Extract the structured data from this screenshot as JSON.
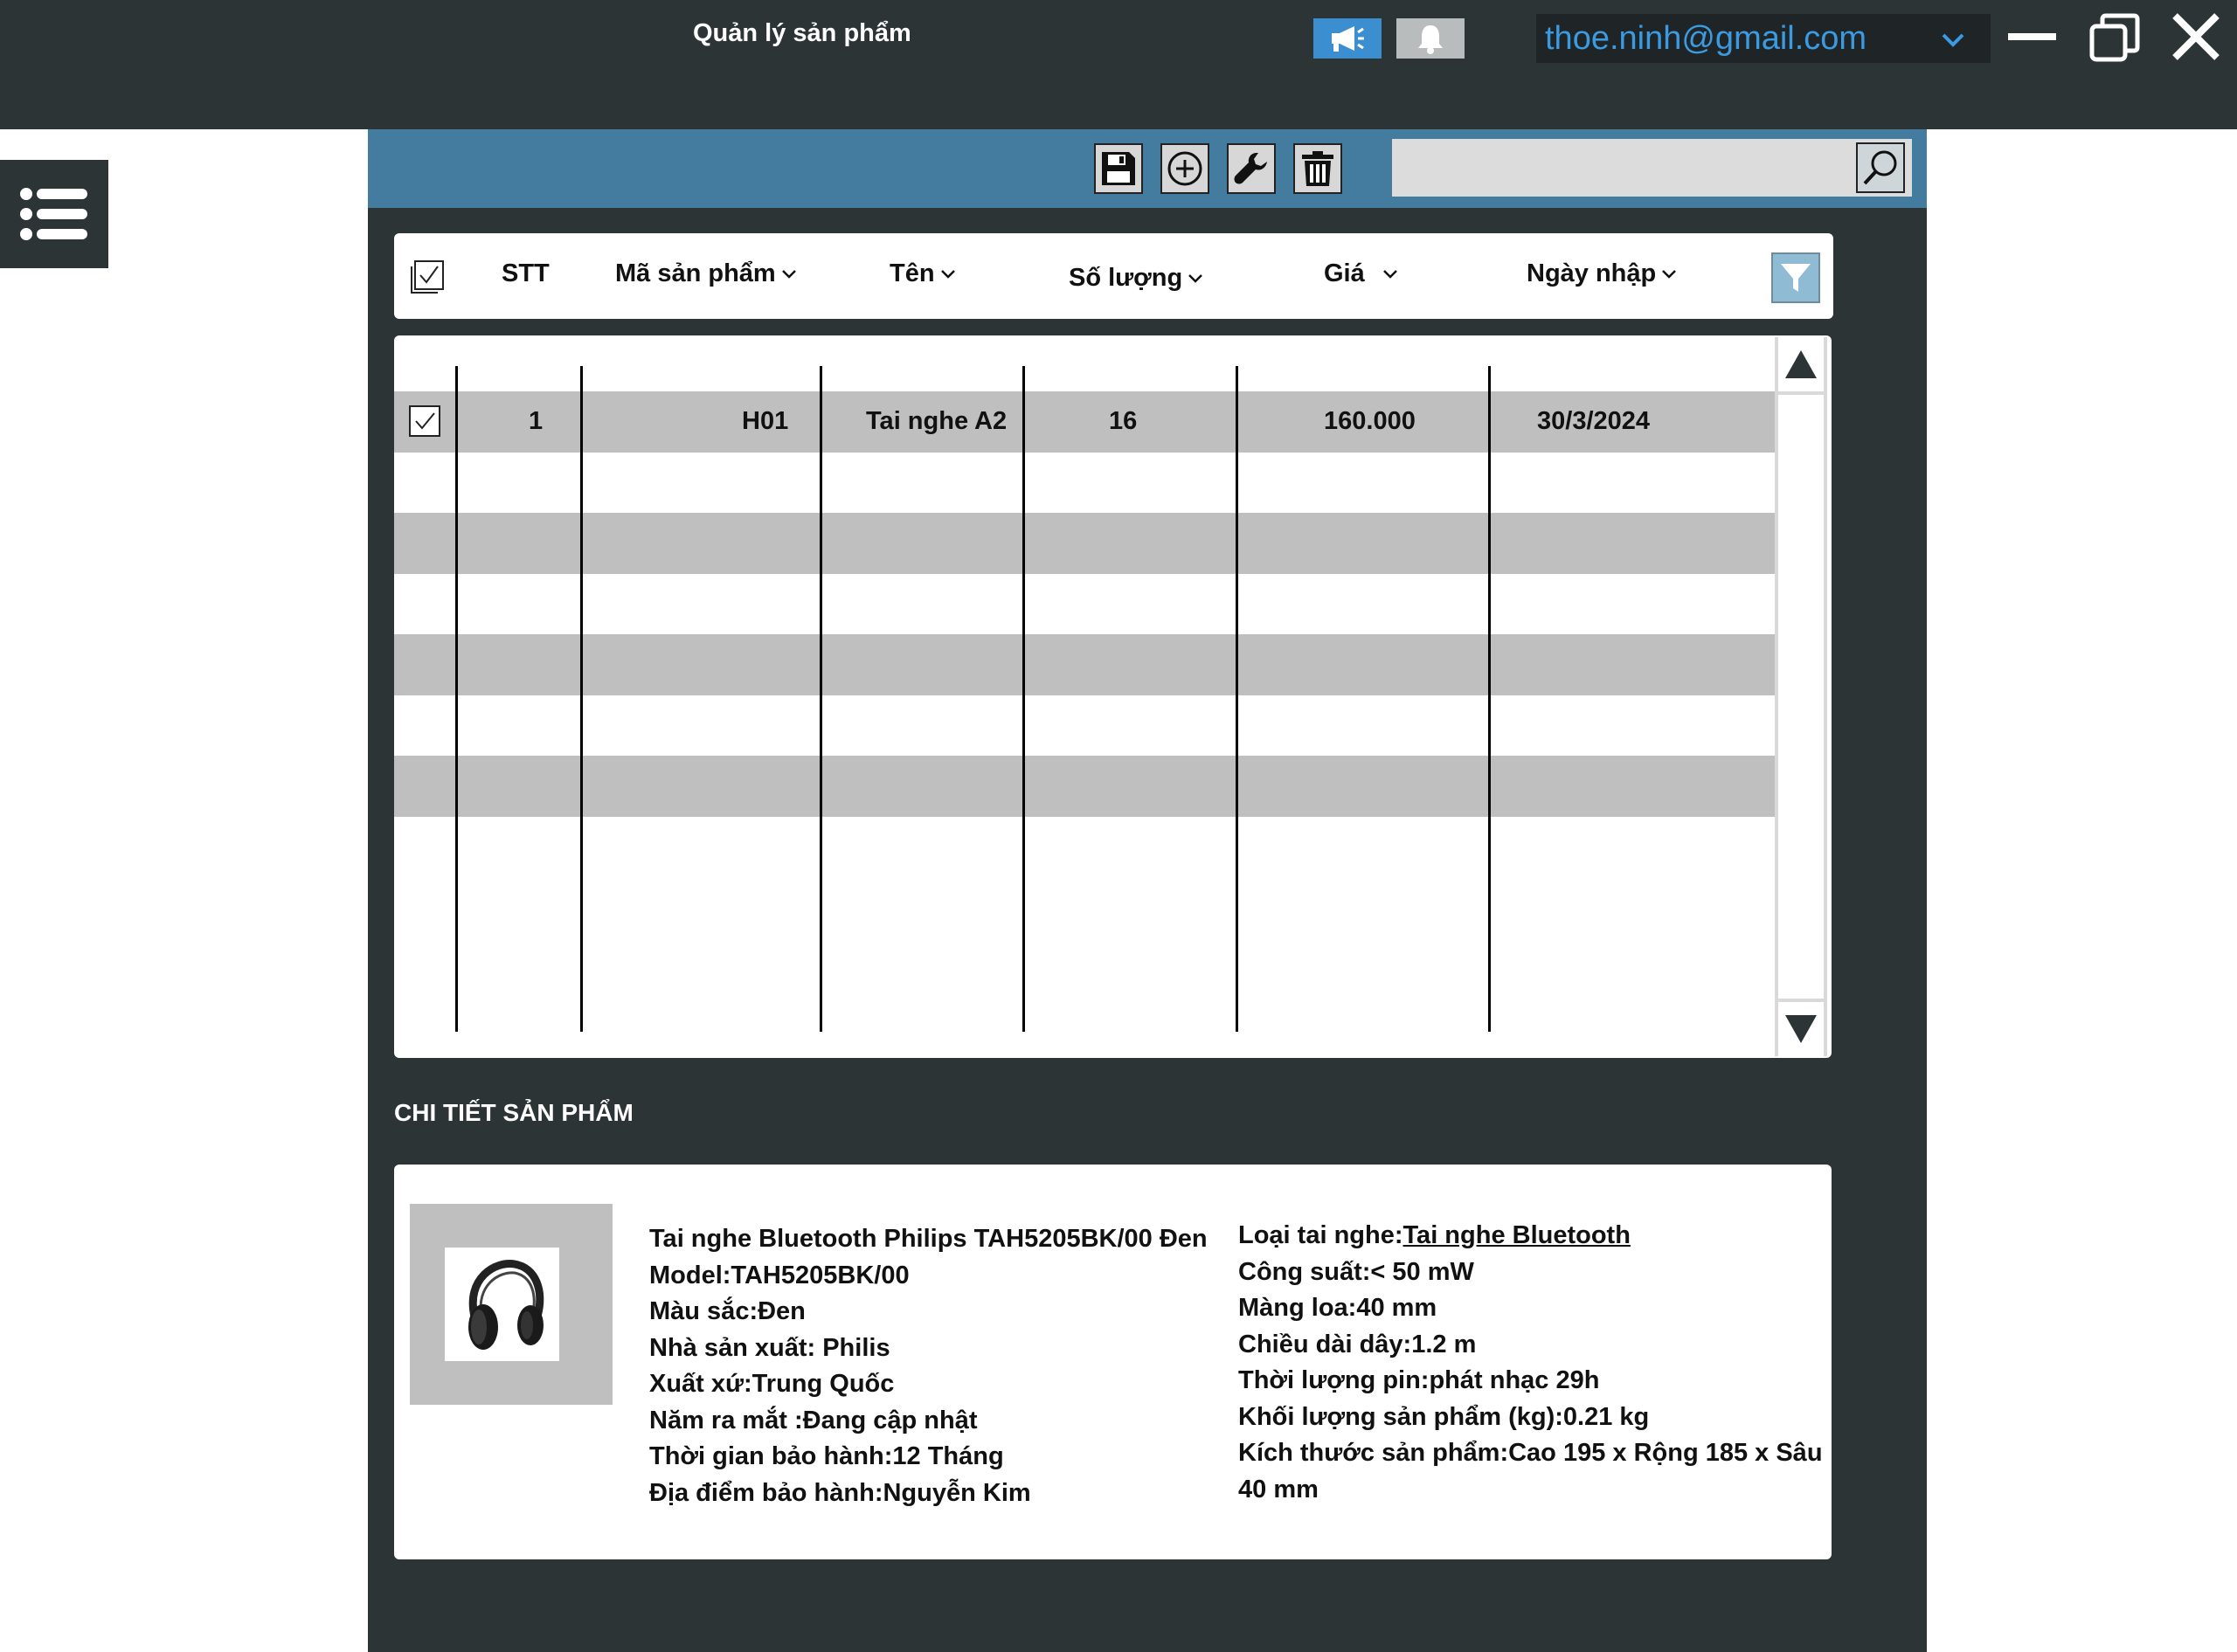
{
  "window": {
    "title": "Quản lý sản phẩm",
    "account_email": "thoe.ninh@gmail.com"
  },
  "table": {
    "headers": {
      "stt": "STT",
      "code": "Mã sản phẩm",
      "name": "Tên",
      "qty": "Số lượng",
      "price": "Giá",
      "date": "Ngày nhập"
    },
    "rows": [
      {
        "stt": "1",
        "code": "H01",
        "name": "Tai nghe A2",
        "qty": "16",
        "price": "160.000",
        "date": "30/3/2024",
        "checked": true
      }
    ]
  },
  "details": {
    "section_title": "CHI TIẾT SẢN PHẨM",
    "left": [
      "Tai nghe Bluetooth Philips TAH5205BK/00 Đen",
      "Model:TAH5205BK/00",
      "Màu sắc:Đen",
      "Nhà sản xuất: Philis",
      "Xuất xứ:Trung Quốc",
      "Năm ra mắt :Đang cập nhật",
      "Thời gian bảo hành:12 Tháng",
      "Địa điểm bảo hành:Nguyễn Kim"
    ],
    "right": {
      "type_label": "Loại tai nghe:",
      "type_value": "Tai nghe Bluetooth",
      "lines": [
        "Công suất:< 50 mW",
        "Màng loa:40 mm",
        "Chiều dài dây:1.2 m",
        "Thời lượng pin:phát nhạc 29h",
        "Khối lượng sản phẩm (kg):0.21 kg",
        "Kích thước sản phẩm:Cao 195 x Rộng 185 x Sâu",
        "40 mm"
      ]
    }
  },
  "colors": {
    "titlebar": "#2d3436",
    "toolbar": "#437c9e",
    "accent": "#3b8fd0",
    "stripe": "#bfbfbf"
  }
}
